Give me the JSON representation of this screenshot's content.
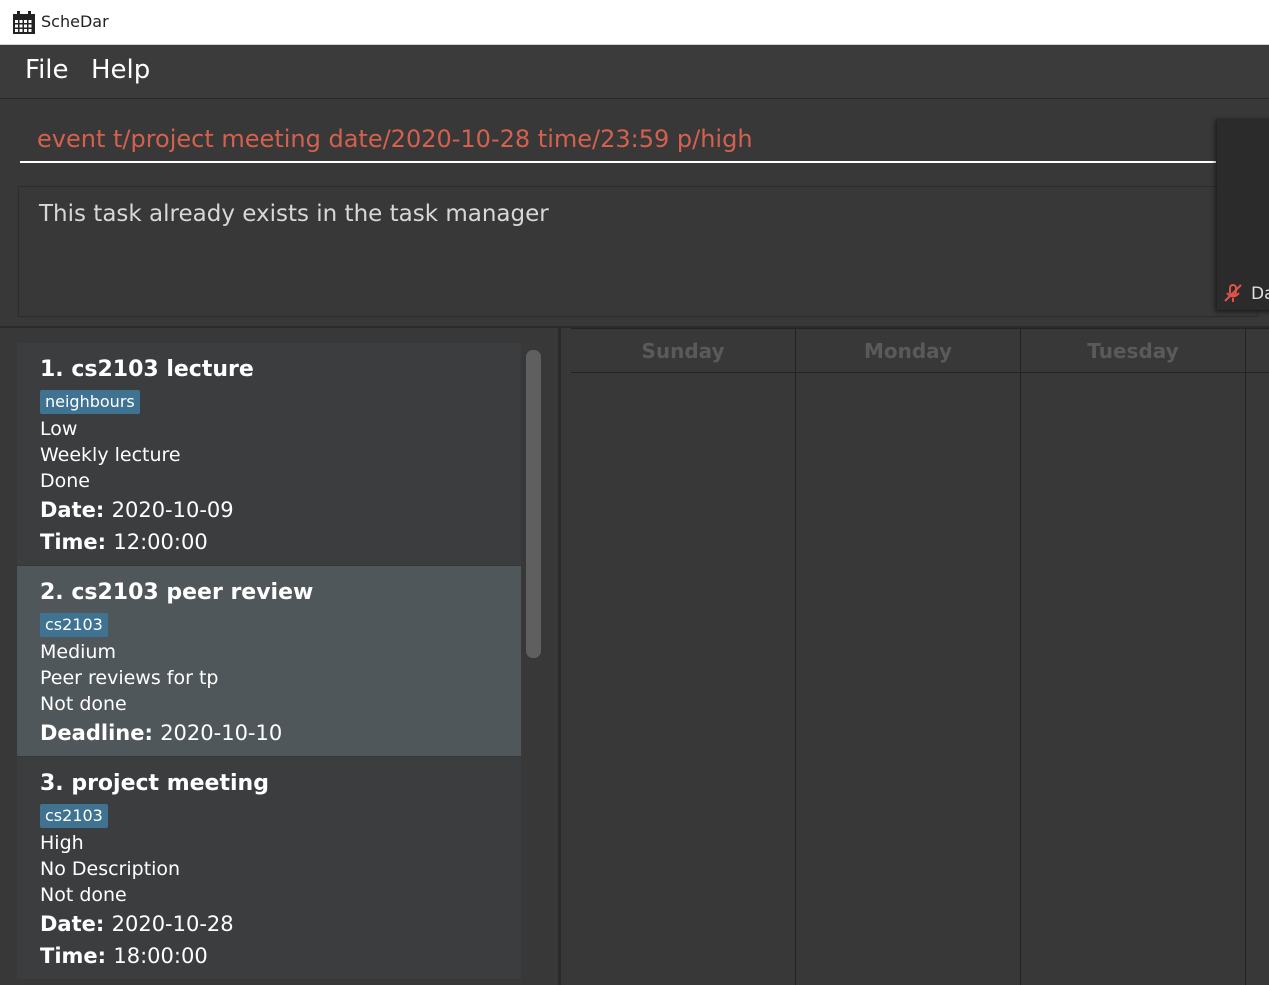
{
  "window": {
    "title": "ScheDar",
    "icon": "calendar-icon"
  },
  "menu": {
    "items": [
      "File",
      "Help"
    ]
  },
  "command": {
    "value": "event t/project meeting date/2020-10-28 time/23:59 p/high"
  },
  "result": {
    "message": "This task already exists in the task manager"
  },
  "popup": {
    "label": "Da",
    "icon": "microphone-off-icon"
  },
  "tasks": [
    {
      "title": "1.  cs2103 lecture",
      "tag": "neighbours",
      "priority": "Low",
      "description": "Weekly lecture",
      "status": "Done",
      "date_label": "Date:",
      "date": "2020-10-09",
      "time_label": "Time:",
      "time": "12:00:00"
    },
    {
      "title": "2.  cs2103 peer review",
      "tag": "cs2103",
      "priority": "Medium",
      "description": "Peer reviews for tp",
      "status": "Not done",
      "deadline_label": "Deadline:",
      "deadline": "2020-10-10"
    },
    {
      "title": "3.  project meeting",
      "tag": "cs2103",
      "priority": "High",
      "description": "No Description",
      "status": "Not done",
      "date_label": "Date:",
      "date": "2020-10-28",
      "time_label": "Time:",
      "time": "18:00:00"
    }
  ],
  "calendar": {
    "days": [
      "Sunday",
      "Monday",
      "Tuesday",
      ""
    ]
  },
  "colors": {
    "background": "#383838",
    "command_text": "#d4604e",
    "tag_background": "#3f7391",
    "selected_card": "#50575b"
  }
}
